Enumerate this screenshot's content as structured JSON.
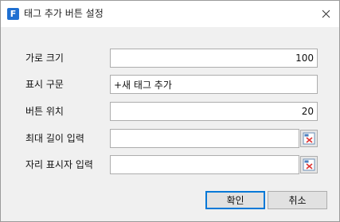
{
  "window": {
    "title": "태그 추가 버튼 설정",
    "app_icon_letter": "F"
  },
  "form": {
    "width": {
      "label": "가로 크기",
      "value": "100"
    },
    "display_text": {
      "label": "표시 구문",
      "value": "+새 태그 추가"
    },
    "button_position": {
      "label": "버튼 위치",
      "value": "20"
    },
    "max_input_length": {
      "label": "최대 길이 입력",
      "value": ""
    },
    "placeholder_input": {
      "label": "자리 표시자 입력",
      "value": ""
    }
  },
  "buttons": {
    "ok": "확인",
    "cancel": "취소"
  },
  "colors": {
    "accent": "#0078d7",
    "app_icon": "#1f6fd1"
  }
}
